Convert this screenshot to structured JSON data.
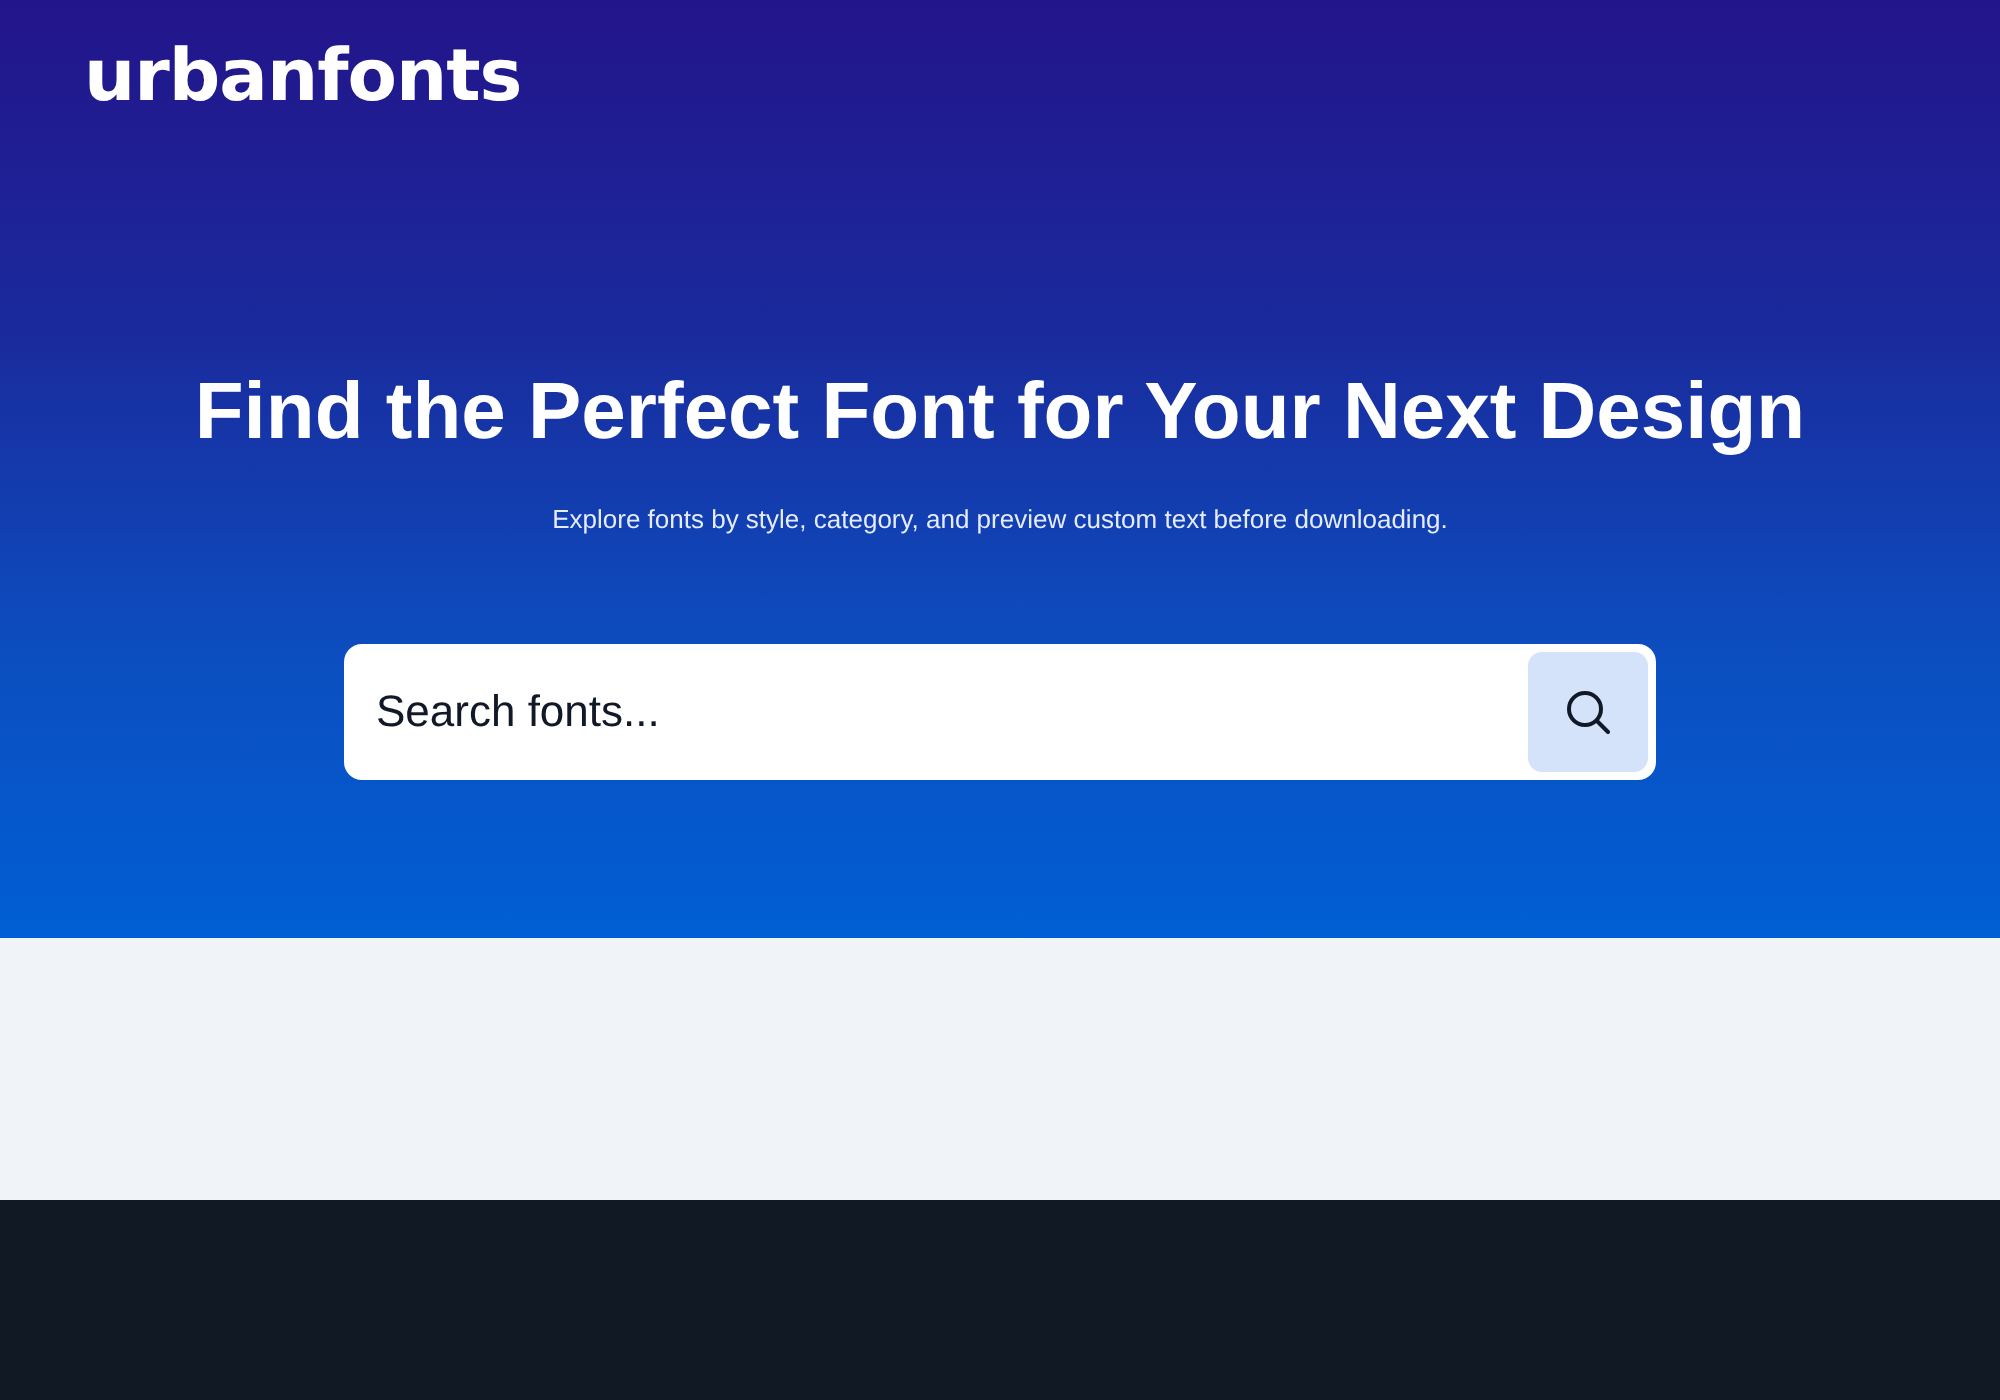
{
  "header": {
    "logo": "urbanfonts"
  },
  "hero": {
    "title": "Find the Perfect Font for Your Next Design",
    "subtitle": "Explore fonts by style, category, and preview custom text before downloading.",
    "search": {
      "placeholder": "Search fonts..."
    }
  }
}
